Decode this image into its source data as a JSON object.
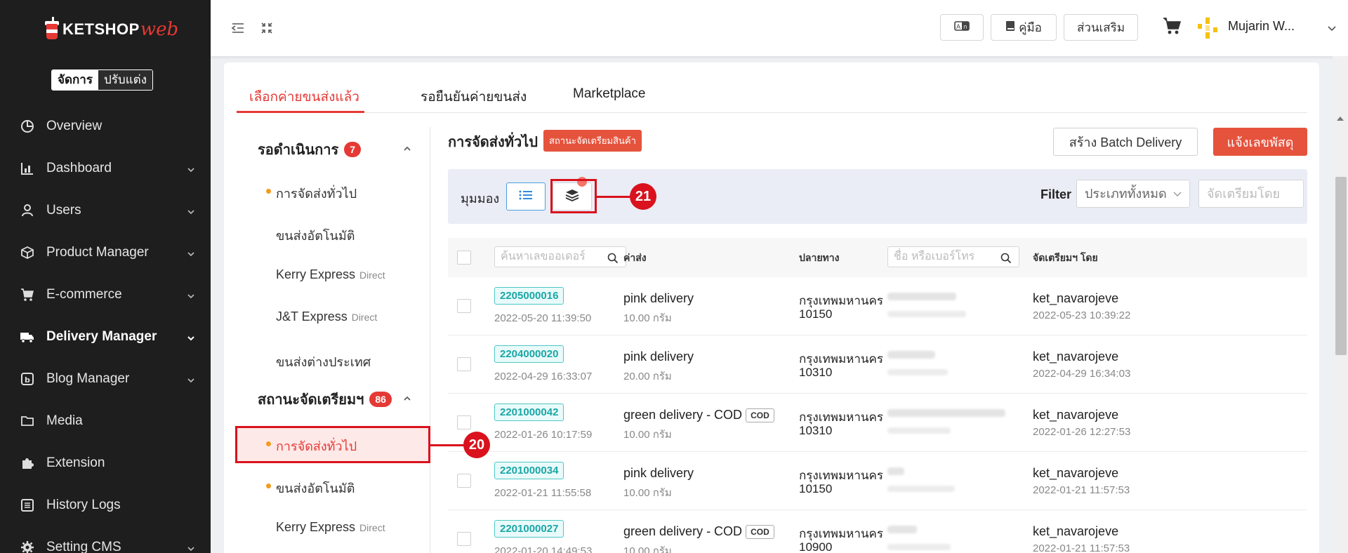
{
  "sidebar": {
    "logo_text": "KETSHOP",
    "logo_suffix": "web",
    "mode_manage": "จัดการ",
    "mode_customize": "ปรับแต่ง",
    "items": [
      {
        "label": "Overview",
        "icon": "pie-chart-icon"
      },
      {
        "label": "Dashboard",
        "icon": "bar-chart-icon"
      },
      {
        "label": "Users",
        "icon": "user-icon"
      },
      {
        "label": "Product Manager",
        "icon": "box-icon"
      },
      {
        "label": "E-commerce",
        "icon": "cart-icon"
      },
      {
        "label": "Delivery Manager",
        "icon": "truck-icon",
        "active": true
      },
      {
        "label": "Blog Manager",
        "icon": "blog-icon"
      },
      {
        "label": "Media",
        "icon": "folder-icon"
      },
      {
        "label": "Extension",
        "icon": "puzzle-icon"
      },
      {
        "label": "History Logs",
        "icon": "list-icon"
      },
      {
        "label": "Setting CMS",
        "icon": "gear-icon"
      }
    ]
  },
  "header": {
    "manual_label": "คู่มือ",
    "addons_label": "ส่วนเสริม",
    "user_name": "Mujarin W..."
  },
  "tabs": [
    "เลือกค่ายขนส่งแล้ว",
    "รอยืนยันค่ายขนส่ง",
    "Marketplace"
  ],
  "left_panel": {
    "pending": {
      "label": "รอดำเนินการ",
      "count": "7"
    },
    "pending_items": [
      {
        "label": "การจัดส่งทั่วไป",
        "suffix": ""
      },
      {
        "label": "ขนส่งอัตโนมัติ",
        "suffix": ""
      },
      {
        "label": "Kerry Express",
        "suffix": "Direct"
      },
      {
        "label": "J&T Express",
        "suffix": "Direct"
      },
      {
        "label": "ขนส่งต่างประเทศ",
        "suffix": ""
      }
    ],
    "preparing": {
      "label": "สถานะจัดเตรียมฯ",
      "count": "86"
    },
    "preparing_items": [
      {
        "label": "การจัดส่งทั่วไป",
        "suffix": ""
      },
      {
        "label": "ขนส่งอัตโนมัติ",
        "suffix": ""
      },
      {
        "label": "Kerry Express",
        "suffix": "Direct"
      }
    ]
  },
  "content": {
    "title": "การจัดส่งทั่วไป",
    "status_badge": "สถานะจัดเตรียมสินค้า",
    "batch_button": "สร้าง Batch Delivery",
    "notify_button": "แจ้งเลขพัสดุ",
    "view_label": "มุมมอง",
    "filter_label": "Filter",
    "filter_select": "ประเภททั้งหมด",
    "filter_input_placeholder": "จัดเตรียมโดย"
  },
  "callouts": {
    "view_layers": "21",
    "preparing_general": "20"
  },
  "table": {
    "search_order_placeholder": "ค้นหาเลขออเดอร์",
    "col_shipping": "ค่าส่ง",
    "col_destination": "ปลายทาง",
    "search_name_placeholder": "ชื่อ หรือเบอร์โทร",
    "col_prepared_by": "จัดเตรียมฯ โดย",
    "rows": [
      {
        "order": "2205000016",
        "date": "2022-05-20 11:39:50",
        "ship": "pink delivery",
        "cod": "",
        "weight": "10.00 กรัม",
        "city": "กรุงเทพมหานคร",
        "zip": "10150",
        "prep_by": "ket_navarojeve",
        "prep_date": "2022-05-23 10:39:22"
      },
      {
        "order": "2204000020",
        "date": "2022-04-29 16:33:07",
        "ship": "pink delivery",
        "cod": "",
        "weight": "20.00 กรัม",
        "city": "กรุงเทพมหานคร",
        "zip": "10310",
        "prep_by": "ket_navarojeve",
        "prep_date": "2022-04-29 16:34:03"
      },
      {
        "order": "2201000042",
        "date": "2022-01-26 10:17:59",
        "ship": "green delivery - COD",
        "cod": "COD",
        "weight": "10.00 กรัม",
        "city": "กรุงเทพมหานคร",
        "zip": "10310",
        "prep_by": "ket_navarojeve",
        "prep_date": "2022-01-26 12:27:53"
      },
      {
        "order": "2201000034",
        "date": "2022-01-21 11:55:58",
        "ship": "pink delivery",
        "cod": "",
        "weight": "10.00 กรัม",
        "city": "กรุงเทพมหานคร",
        "zip": "10150",
        "prep_by": "ket_navarojeve",
        "prep_date": "2022-01-21 11:57:53"
      },
      {
        "order": "2201000027",
        "date": "2022-01-20 14:49:53",
        "ship": "green delivery - COD",
        "cod": "COD",
        "weight": "10.00 กรัม",
        "city": "กรุงเทพมหานคร",
        "zip": "10900",
        "prep_by": "ket_navarojeve",
        "prep_date": "2022-01-21 11:57:53"
      }
    ]
  }
}
